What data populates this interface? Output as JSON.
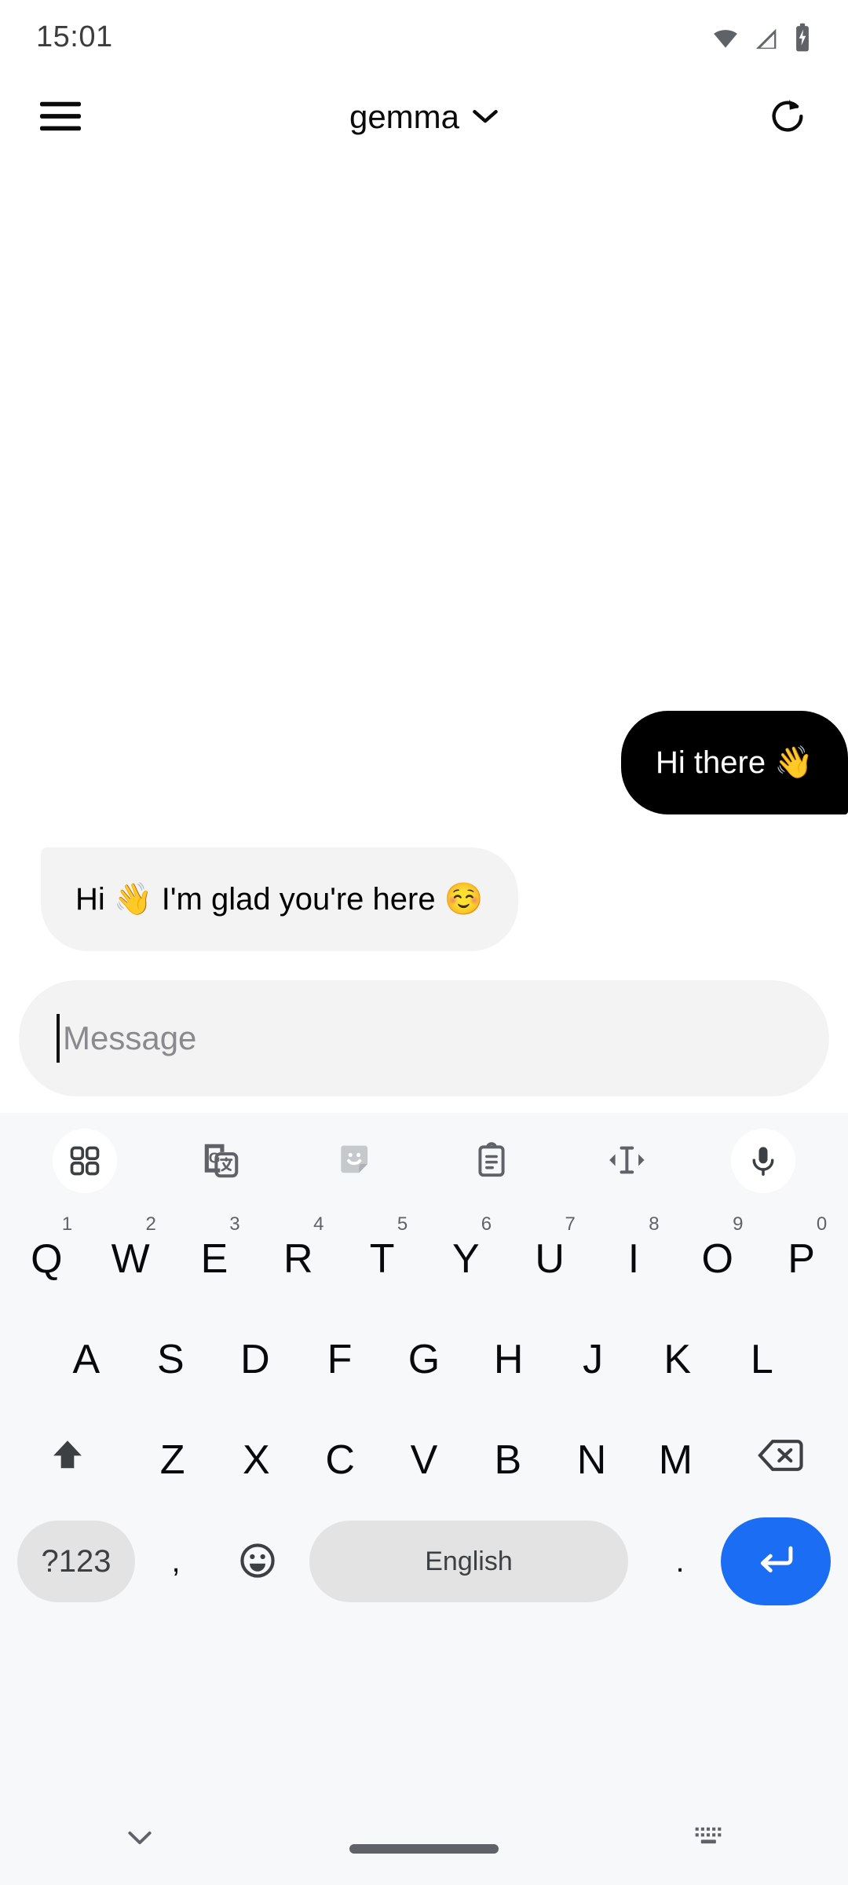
{
  "status_bar": {
    "time": "15:01",
    "icons": [
      "wifi-icon",
      "cellular-signal-icon",
      "battery-charging-icon"
    ]
  },
  "app_bar": {
    "menu_icon": "hamburger-menu-icon",
    "title": "gemma",
    "title_chevron": "chevron-down-icon",
    "refresh_icon": "refresh-icon"
  },
  "conversation": {
    "messages": [
      {
        "role": "user",
        "text": "Hi there 👋"
      },
      {
        "role": "assistant",
        "text": "Hi 👋 I'm glad you're here ☺️"
      }
    ]
  },
  "composer": {
    "placeholder": "Message",
    "value": ""
  },
  "keyboard": {
    "toolbar": [
      {
        "name": "apps-grid-icon",
        "highlighted": true
      },
      {
        "name": "google-translate-icon",
        "highlighted": false
      },
      {
        "name": "sticker-icon",
        "highlighted": false
      },
      {
        "name": "clipboard-icon",
        "highlighted": false
      },
      {
        "name": "text-cursor-move-icon",
        "highlighted": false
      },
      {
        "name": "microphone-icon",
        "highlighted": true
      }
    ],
    "row1": [
      {
        "key": "Q",
        "hint": "1"
      },
      {
        "key": "W",
        "hint": "2"
      },
      {
        "key": "E",
        "hint": "3"
      },
      {
        "key": "R",
        "hint": "4"
      },
      {
        "key": "T",
        "hint": "5"
      },
      {
        "key": "Y",
        "hint": "6"
      },
      {
        "key": "U",
        "hint": "7"
      },
      {
        "key": "I",
        "hint": "8"
      },
      {
        "key": "O",
        "hint": "9"
      },
      {
        "key": "P",
        "hint": "0"
      }
    ],
    "row2": [
      "A",
      "S",
      "D",
      "F",
      "G",
      "H",
      "J",
      "K",
      "L"
    ],
    "row3": [
      "Z",
      "X",
      "C",
      "V",
      "B",
      "N",
      "M"
    ],
    "shift_icon": "shift-up-arrow-icon",
    "backspace_icon": "backspace-icon",
    "bottom": {
      "symbols_label": "?123",
      "comma": ",",
      "emoji_icon": "emoji-face-icon",
      "space_label": "English",
      "period": ".",
      "enter_icon": "enter-return-icon"
    }
  },
  "nav_bar": {
    "hide_keyboard_icon": "chevron-down-icon",
    "home_indicator": "home-gesture-pill",
    "switch_keyboard_icon": "keyboard-switch-icon"
  },
  "colors": {
    "user_bubble_bg": "#000000",
    "user_bubble_text": "#ffffff",
    "assistant_bubble_bg": "#f3f3f4",
    "assistant_bubble_text": "#000000",
    "keyboard_bg": "#f7f8fa",
    "enter_key_bg": "#1b6ef3",
    "key_pill_bg": "#e3e3e3",
    "placeholder_text": "#8a8a8e"
  }
}
